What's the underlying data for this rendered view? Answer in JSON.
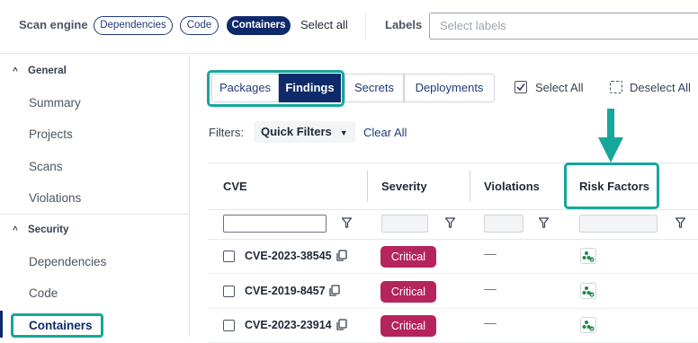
{
  "topbar": {
    "scan_engine_label": "Scan engine",
    "chips": [
      {
        "label": "Dependencies",
        "active": false
      },
      {
        "label": "Code",
        "active": false
      },
      {
        "label": "Containers",
        "active": true
      }
    ],
    "select_all": "Select all",
    "labels_label": "Labels",
    "labels_placeholder": "Select labels"
  },
  "sidebar": {
    "sections": [
      {
        "title": "General",
        "items": [
          "Summary",
          "Projects",
          "Scans",
          "Violations"
        ]
      },
      {
        "title": "Security",
        "items": [
          "Dependencies",
          "Code",
          "Containers"
        ]
      }
    ],
    "active_item": "Containers"
  },
  "main": {
    "tabs": [
      {
        "label": "Packages",
        "active": false
      },
      {
        "label": "Findings",
        "active": true
      },
      {
        "label": "Secrets",
        "active": false
      },
      {
        "label": "Deployments",
        "active": false
      }
    ],
    "select_all": "Select All",
    "deselect_all": "Deselect All",
    "filters_label": "Filters:",
    "quick_filters": "Quick Filters",
    "clear_all": "Clear All",
    "table": {
      "columns": [
        "CVE",
        "Severity",
        "Violations",
        "Risk Factors"
      ],
      "rows": [
        {
          "cve": "CVE-2023-38545",
          "severity": "Critical",
          "violations": "—",
          "risk_icon": "risk-factor-icon"
        },
        {
          "cve": "CVE-2019-8457",
          "severity": "Critical",
          "violations": "—",
          "risk_icon": "risk-factor-icon"
        },
        {
          "cve": "CVE-2023-23914",
          "severity": "Critical",
          "violations": "—",
          "risk_icon": "risk-factor-icon"
        }
      ]
    }
  },
  "colors": {
    "brand": "#0f2a6b",
    "highlight": "#16a79b",
    "critical": "#b5245c",
    "risk_icon": "#1f8a4c"
  }
}
